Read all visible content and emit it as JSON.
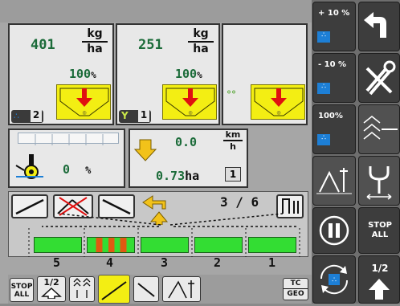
{
  "products": [
    {
      "rate": "401",
      "unit_top": "kg",
      "unit_bottom": "ha",
      "percent": "100",
      "percent_sign": "%",
      "meter_number": "2"
    },
    {
      "rate": "251",
      "unit_top": "kg",
      "unit_bottom": "ha",
      "percent": "100",
      "percent_sign": "%",
      "meter_number": "1"
    },
    {
      "rate": "",
      "unit_top": "",
      "unit_bottom": "",
      "percent": "",
      "percent_sign": "",
      "meter_number": ""
    }
  ],
  "fill_level": {
    "value": "0",
    "unit": "%"
  },
  "speed": {
    "value": "0.0",
    "unit_top": "km",
    "unit_bottom": "h"
  },
  "area": {
    "value": "0.73",
    "unit": "ha",
    "counter": "1"
  },
  "sections": {
    "active_count": "3 / 6",
    "labels": [
      "5",
      "4",
      "3",
      "2",
      "1"
    ],
    "colors": {
      "on": "#33dd33",
      "partial": "#e05a12"
    }
  },
  "right_column": {
    "increase_label": "+ 10 %",
    "decrease_label": "- 10 %",
    "reset_label": "100%",
    "stop_all_label": "STOP\nALL",
    "half_label": "1/2"
  },
  "bottom_bar": {
    "stop_all_label": "STOP\nALL",
    "half_label": "1/2",
    "tc_label": "TC",
    "geo_label": "GEO"
  },
  "colors": {
    "accent_yellow": "#f3ee13",
    "hopper_red": "#e01010",
    "value_green": "#1b6b39",
    "dot_blue": "#1d7fd6"
  }
}
